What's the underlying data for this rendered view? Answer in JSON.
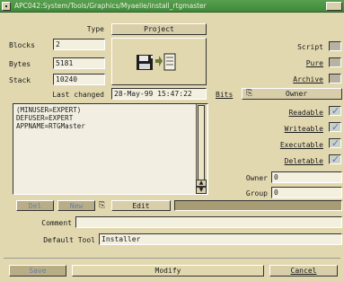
{
  "window": {
    "title": "APC042:System/Tools/Graphics/Myaelle/install_rtgmaster"
  },
  "type_section": {
    "type_label": "Type",
    "type_value": "Project"
  },
  "info": {
    "blocks_label": "Blocks",
    "blocks_value": "2",
    "bytes_label": "Bytes",
    "bytes_value": "5181",
    "stack_label": "Stack",
    "stack_value": "10240",
    "last_changed_label": "Last changed",
    "last_changed_value": "28-May-99 15:47:22"
  },
  "protection": {
    "script_label": "Script",
    "pure_label": "Pure",
    "archive_label": "Archive",
    "bits_label": "Bits",
    "owner_cycle_label": "Owner",
    "readable_label": "Readable",
    "writeable_label": "Writeable",
    "executable_label": "Executable",
    "deletable_label": "Deletable",
    "owner_label": "Owner",
    "owner_value": "0",
    "group_label": "Group",
    "group_value": "0"
  },
  "tooltypes": {
    "lines": [
      "(MINUSER=EXPERT)",
      "DEFUSER=EXPERT",
      "APPNAME=RTGMaster"
    ],
    "del_label": "Del",
    "new_label": "New",
    "edit_label": "Edit",
    "scroll_up_glyph": "▲",
    "scroll_down_glyph": "▼"
  },
  "comment": {
    "label": "Comment",
    "value": ""
  },
  "default_tool": {
    "label": "Default Tool",
    "value": "Installer"
  },
  "footer": {
    "save_label": "Save",
    "modify_label": "Modify",
    "cancel_label": "Cancel"
  },
  "colors": {
    "background": "#e2d8b0",
    "titlebar": "#4e9a48",
    "field": "#f4f0e0",
    "check": "#7070b0"
  }
}
